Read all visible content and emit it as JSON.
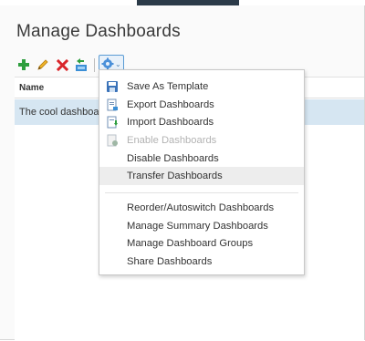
{
  "header": {
    "title": "Manage Dashboards"
  },
  "toolbar": {
    "buttons": [
      {
        "name": "add",
        "icon": "plus-icon",
        "color": "#2e9e3e"
      },
      {
        "name": "edit",
        "icon": "pencil-icon",
        "color": "#e6a817"
      },
      {
        "name": "delete",
        "icon": "x-icon",
        "color": "#d9252a"
      },
      {
        "name": "clone",
        "icon": "clone-dashboard-icon",
        "color": "#3b8fd6"
      }
    ],
    "gear_icon": "gear-icon",
    "gear_caret": "⌄"
  },
  "grid": {
    "columns": [
      "Name"
    ],
    "rows": [
      {
        "name": "The cool dashboa",
        "selected": true
      }
    ],
    "selected_row_color": "#d6e6f2"
  },
  "menu": {
    "group1": [
      {
        "label": "Save As Template",
        "icon": "save-icon",
        "disabled": false
      },
      {
        "label": "Export Dashboards",
        "icon": "export-icon",
        "disabled": false
      },
      {
        "label": "Import Dashboards",
        "icon": "import-icon",
        "disabled": false
      },
      {
        "label": "Enable Dashboards",
        "icon": "enable-icon",
        "disabled": true
      },
      {
        "label": "Disable Dashboards",
        "icon": "",
        "disabled": false
      },
      {
        "label": "Transfer Dashboards",
        "icon": "",
        "disabled": false,
        "hovered": true
      }
    ],
    "group2": [
      {
        "label": "Reorder/Autoswitch Dashboards"
      },
      {
        "label": "Manage Summary Dashboards"
      },
      {
        "label": "Manage Dashboard Groups"
      },
      {
        "label": "Share Dashboards"
      }
    ]
  }
}
